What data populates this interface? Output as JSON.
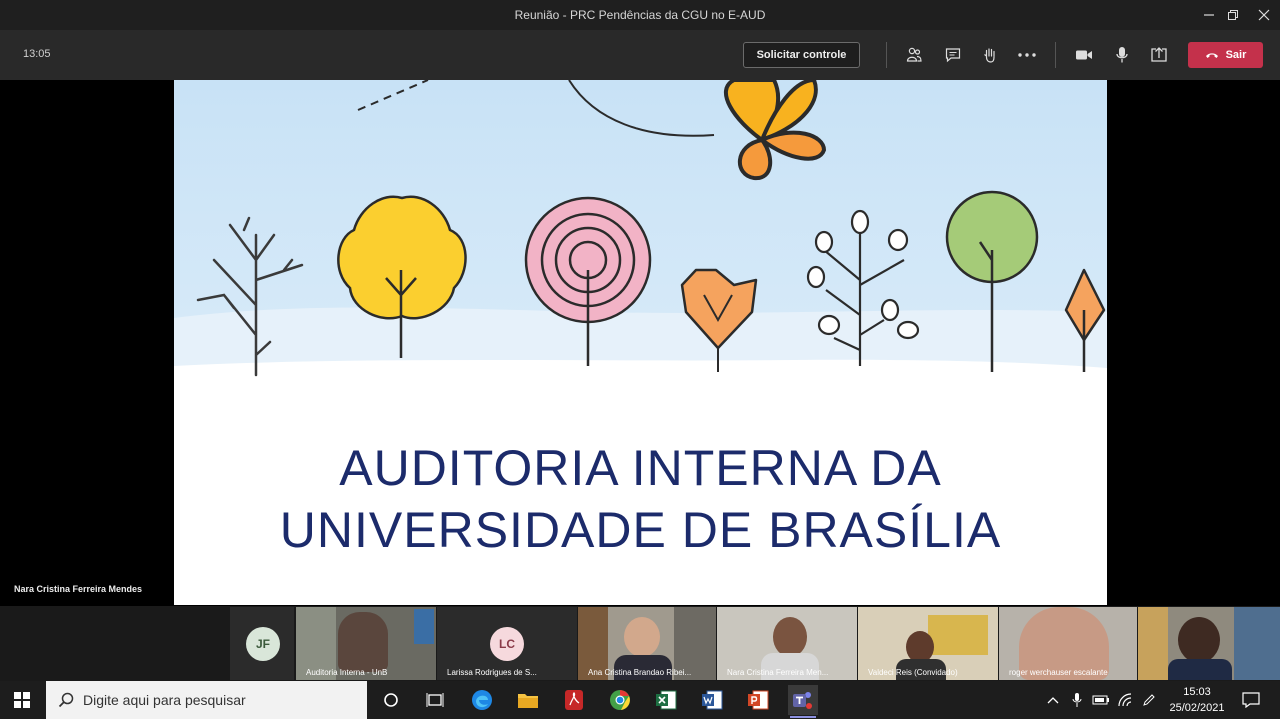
{
  "window": {
    "title": "Reunião - PRC Pendências da CGU no E-AUD"
  },
  "toolbar": {
    "time": "13:05",
    "request_control": "Solicitar controle",
    "leave": "Sair"
  },
  "stage": {
    "presenter_name": "Nara Cristina Ferreira Mendes"
  },
  "slide": {
    "line1": "AUDITORIA INTERNA DA",
    "line2": "UNIVERSIDADE DE BRASÍLIA"
  },
  "participants": [
    {
      "initials": "JF",
      "name": ""
    },
    {
      "initials": "",
      "name": "Auditoria Interna - UnB"
    },
    {
      "initials": "LC",
      "name": "Larissa Rodrigues de S..."
    },
    {
      "initials": "",
      "name": "Ana Cristina Brandao Ribei..."
    },
    {
      "initials": "",
      "name": "Nara Cristina Ferreira Men..."
    },
    {
      "initials": "",
      "name": "Valdeci Reis (Convidado)"
    },
    {
      "initials": "",
      "name": "roger werchauser escalante"
    },
    {
      "initials": "",
      "name": ""
    }
  ],
  "taskbar": {
    "search_placeholder": "Digite aqui para pesquisar",
    "time": "15:03",
    "date": "25/02/2021"
  },
  "colors": {
    "leave_button": "#c4314b",
    "slide_title": "#1c2b6b",
    "teams_accent": "#6264a7"
  }
}
